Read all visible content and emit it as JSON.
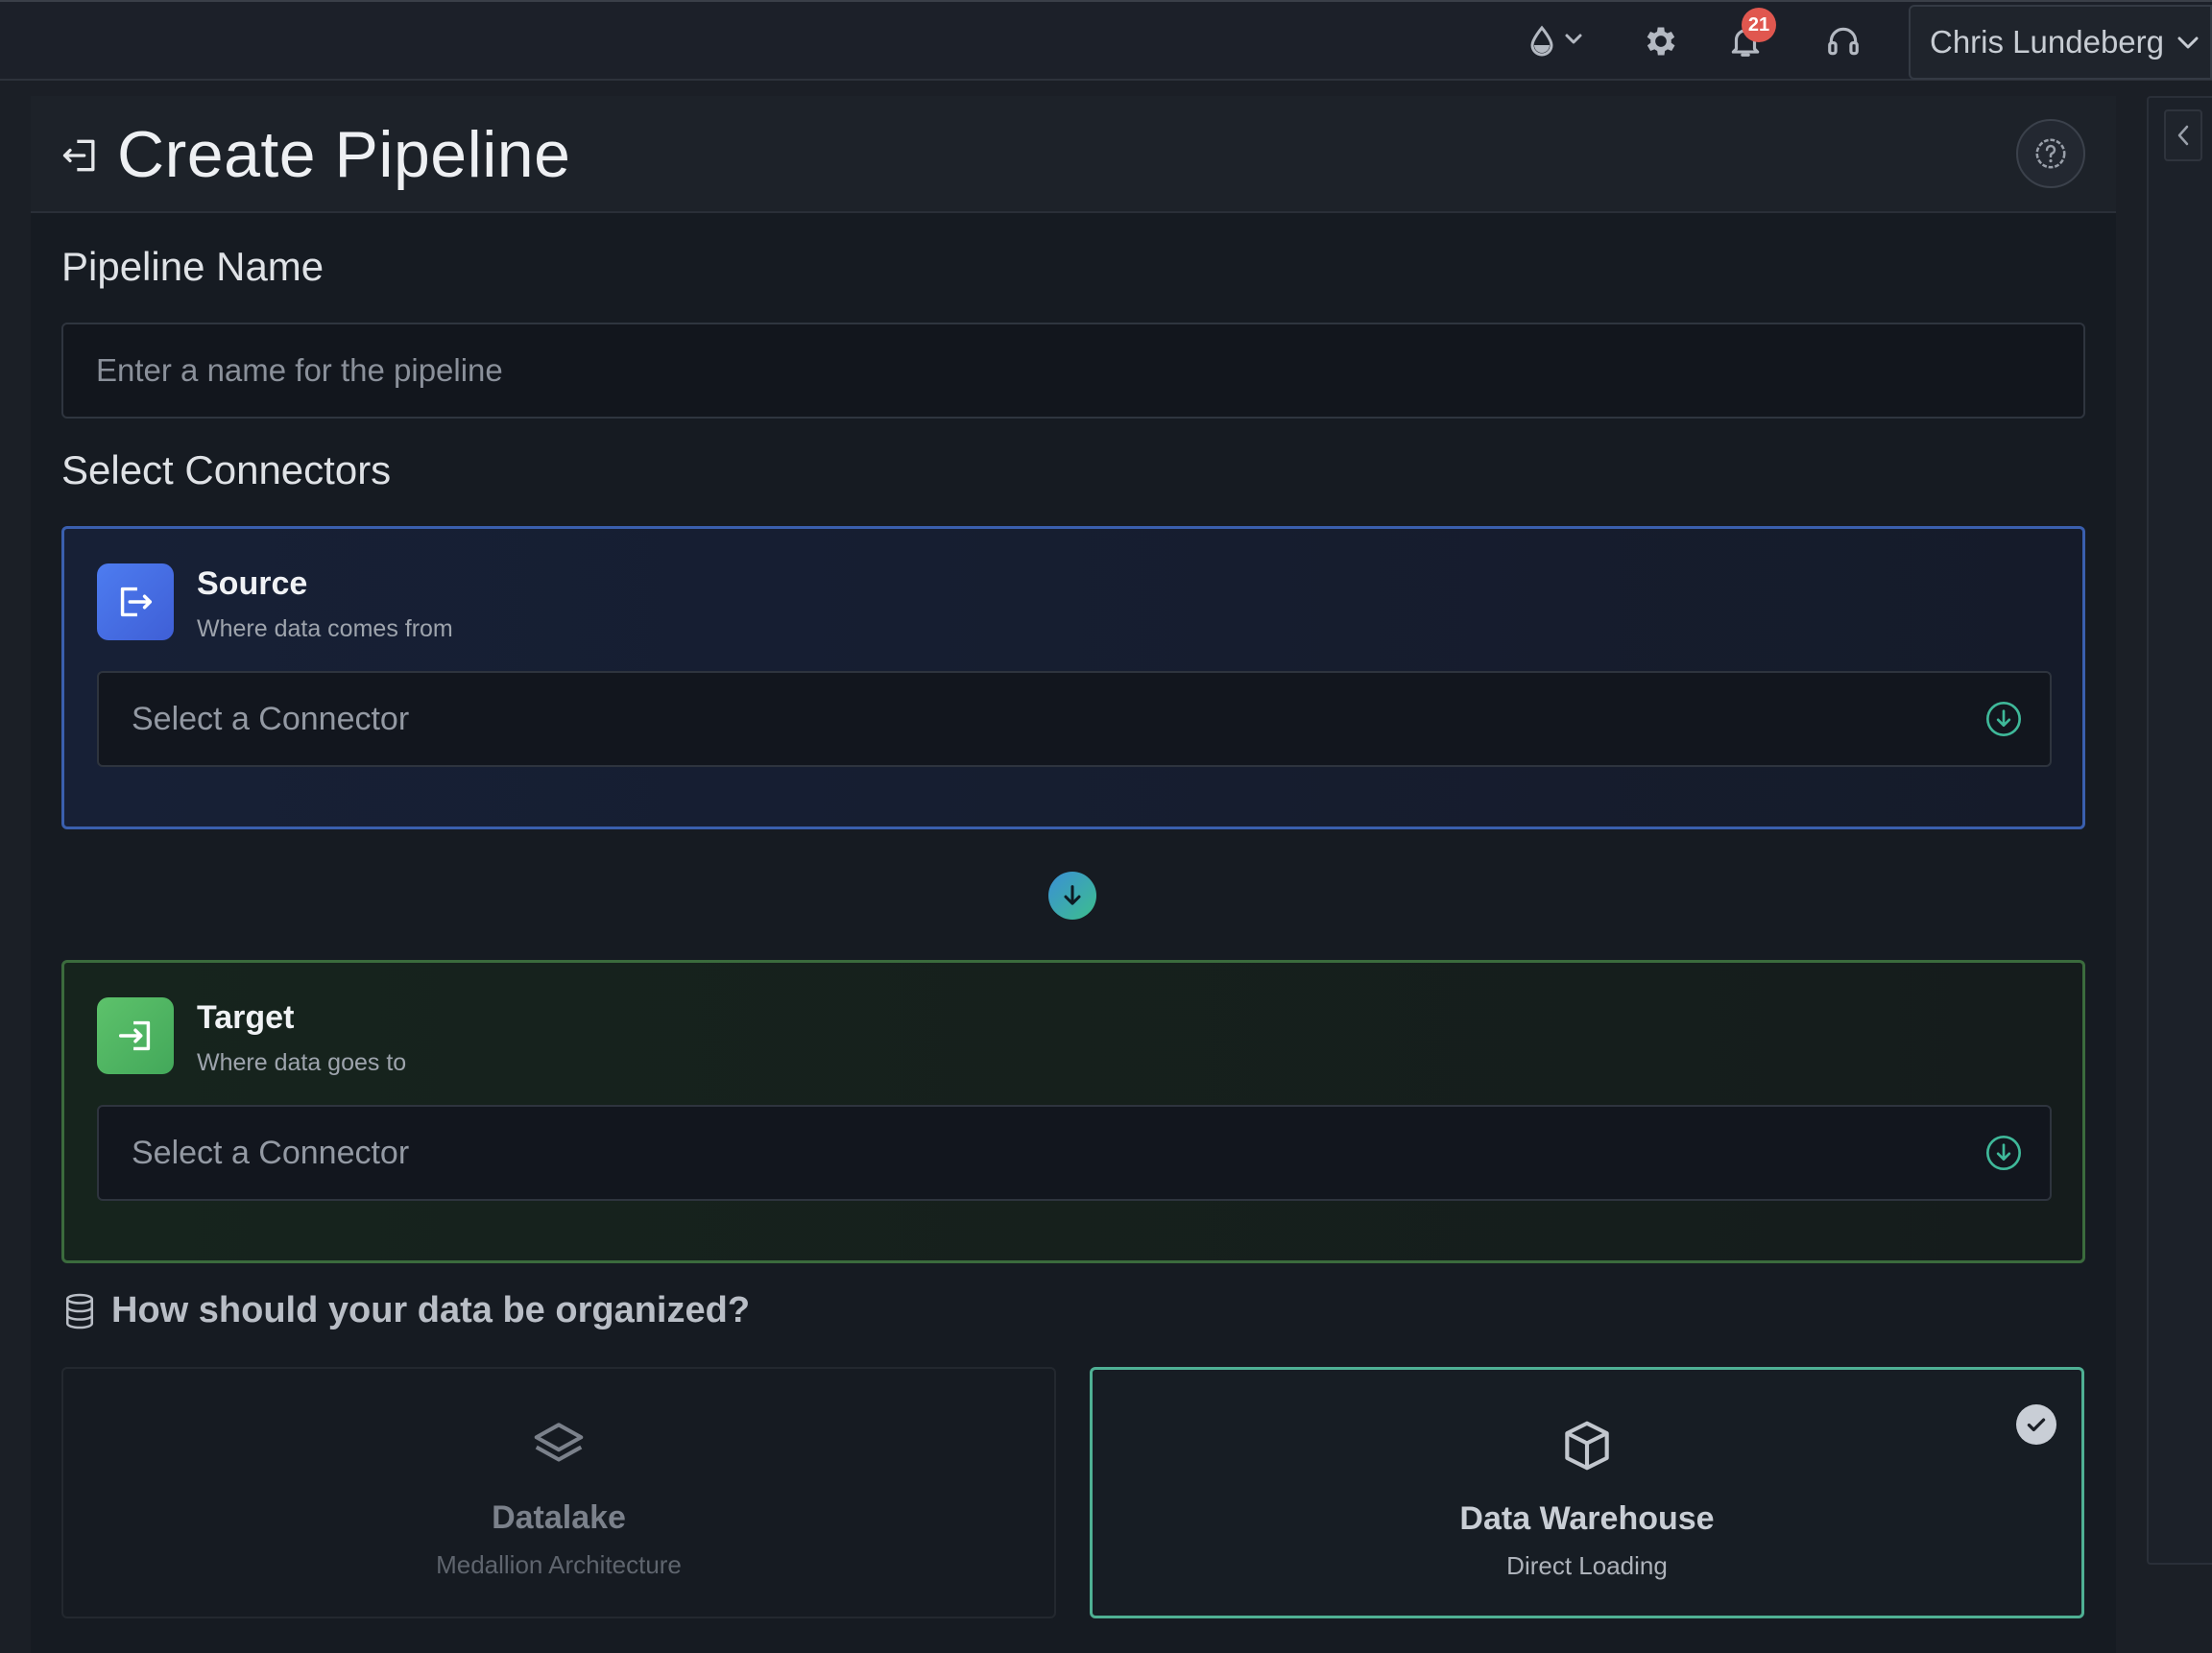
{
  "topbar": {
    "notifications_count": "21",
    "user_name": "Chris Lundeberg",
    "icons": {
      "theme": "water-drop-icon",
      "settings": "gear-icon",
      "notifications": "bell-icon",
      "support": "headset-icon"
    }
  },
  "page": {
    "title": "Create Pipeline",
    "back_icon": "back-arrow-icon",
    "help_icon": "help-icon"
  },
  "pipeline_name": {
    "label": "Pipeline Name",
    "placeholder": "Enter a name for the pipeline",
    "value": ""
  },
  "connectors": {
    "label": "Select Connectors",
    "source": {
      "title": "Source",
      "subtitle": "Where data comes from",
      "select_placeholder": "Select a Connector"
    },
    "target": {
      "title": "Target",
      "subtitle": "Where data goes to",
      "select_placeholder": "Select a Connector"
    }
  },
  "organization": {
    "question": "How should your data be organized?",
    "options": [
      {
        "title": "Datalake",
        "subtitle": "Medallion Architecture",
        "selected": false,
        "icon": "layers-icon"
      },
      {
        "title": "Data Warehouse",
        "subtitle": "Direct Loading",
        "selected": true,
        "icon": "cube-icon"
      }
    ]
  },
  "colors": {
    "source_accent": "#4d7cf0",
    "target_accent": "#5dc26b",
    "selected_border": "#4fb094",
    "badge": "#e0574f"
  }
}
